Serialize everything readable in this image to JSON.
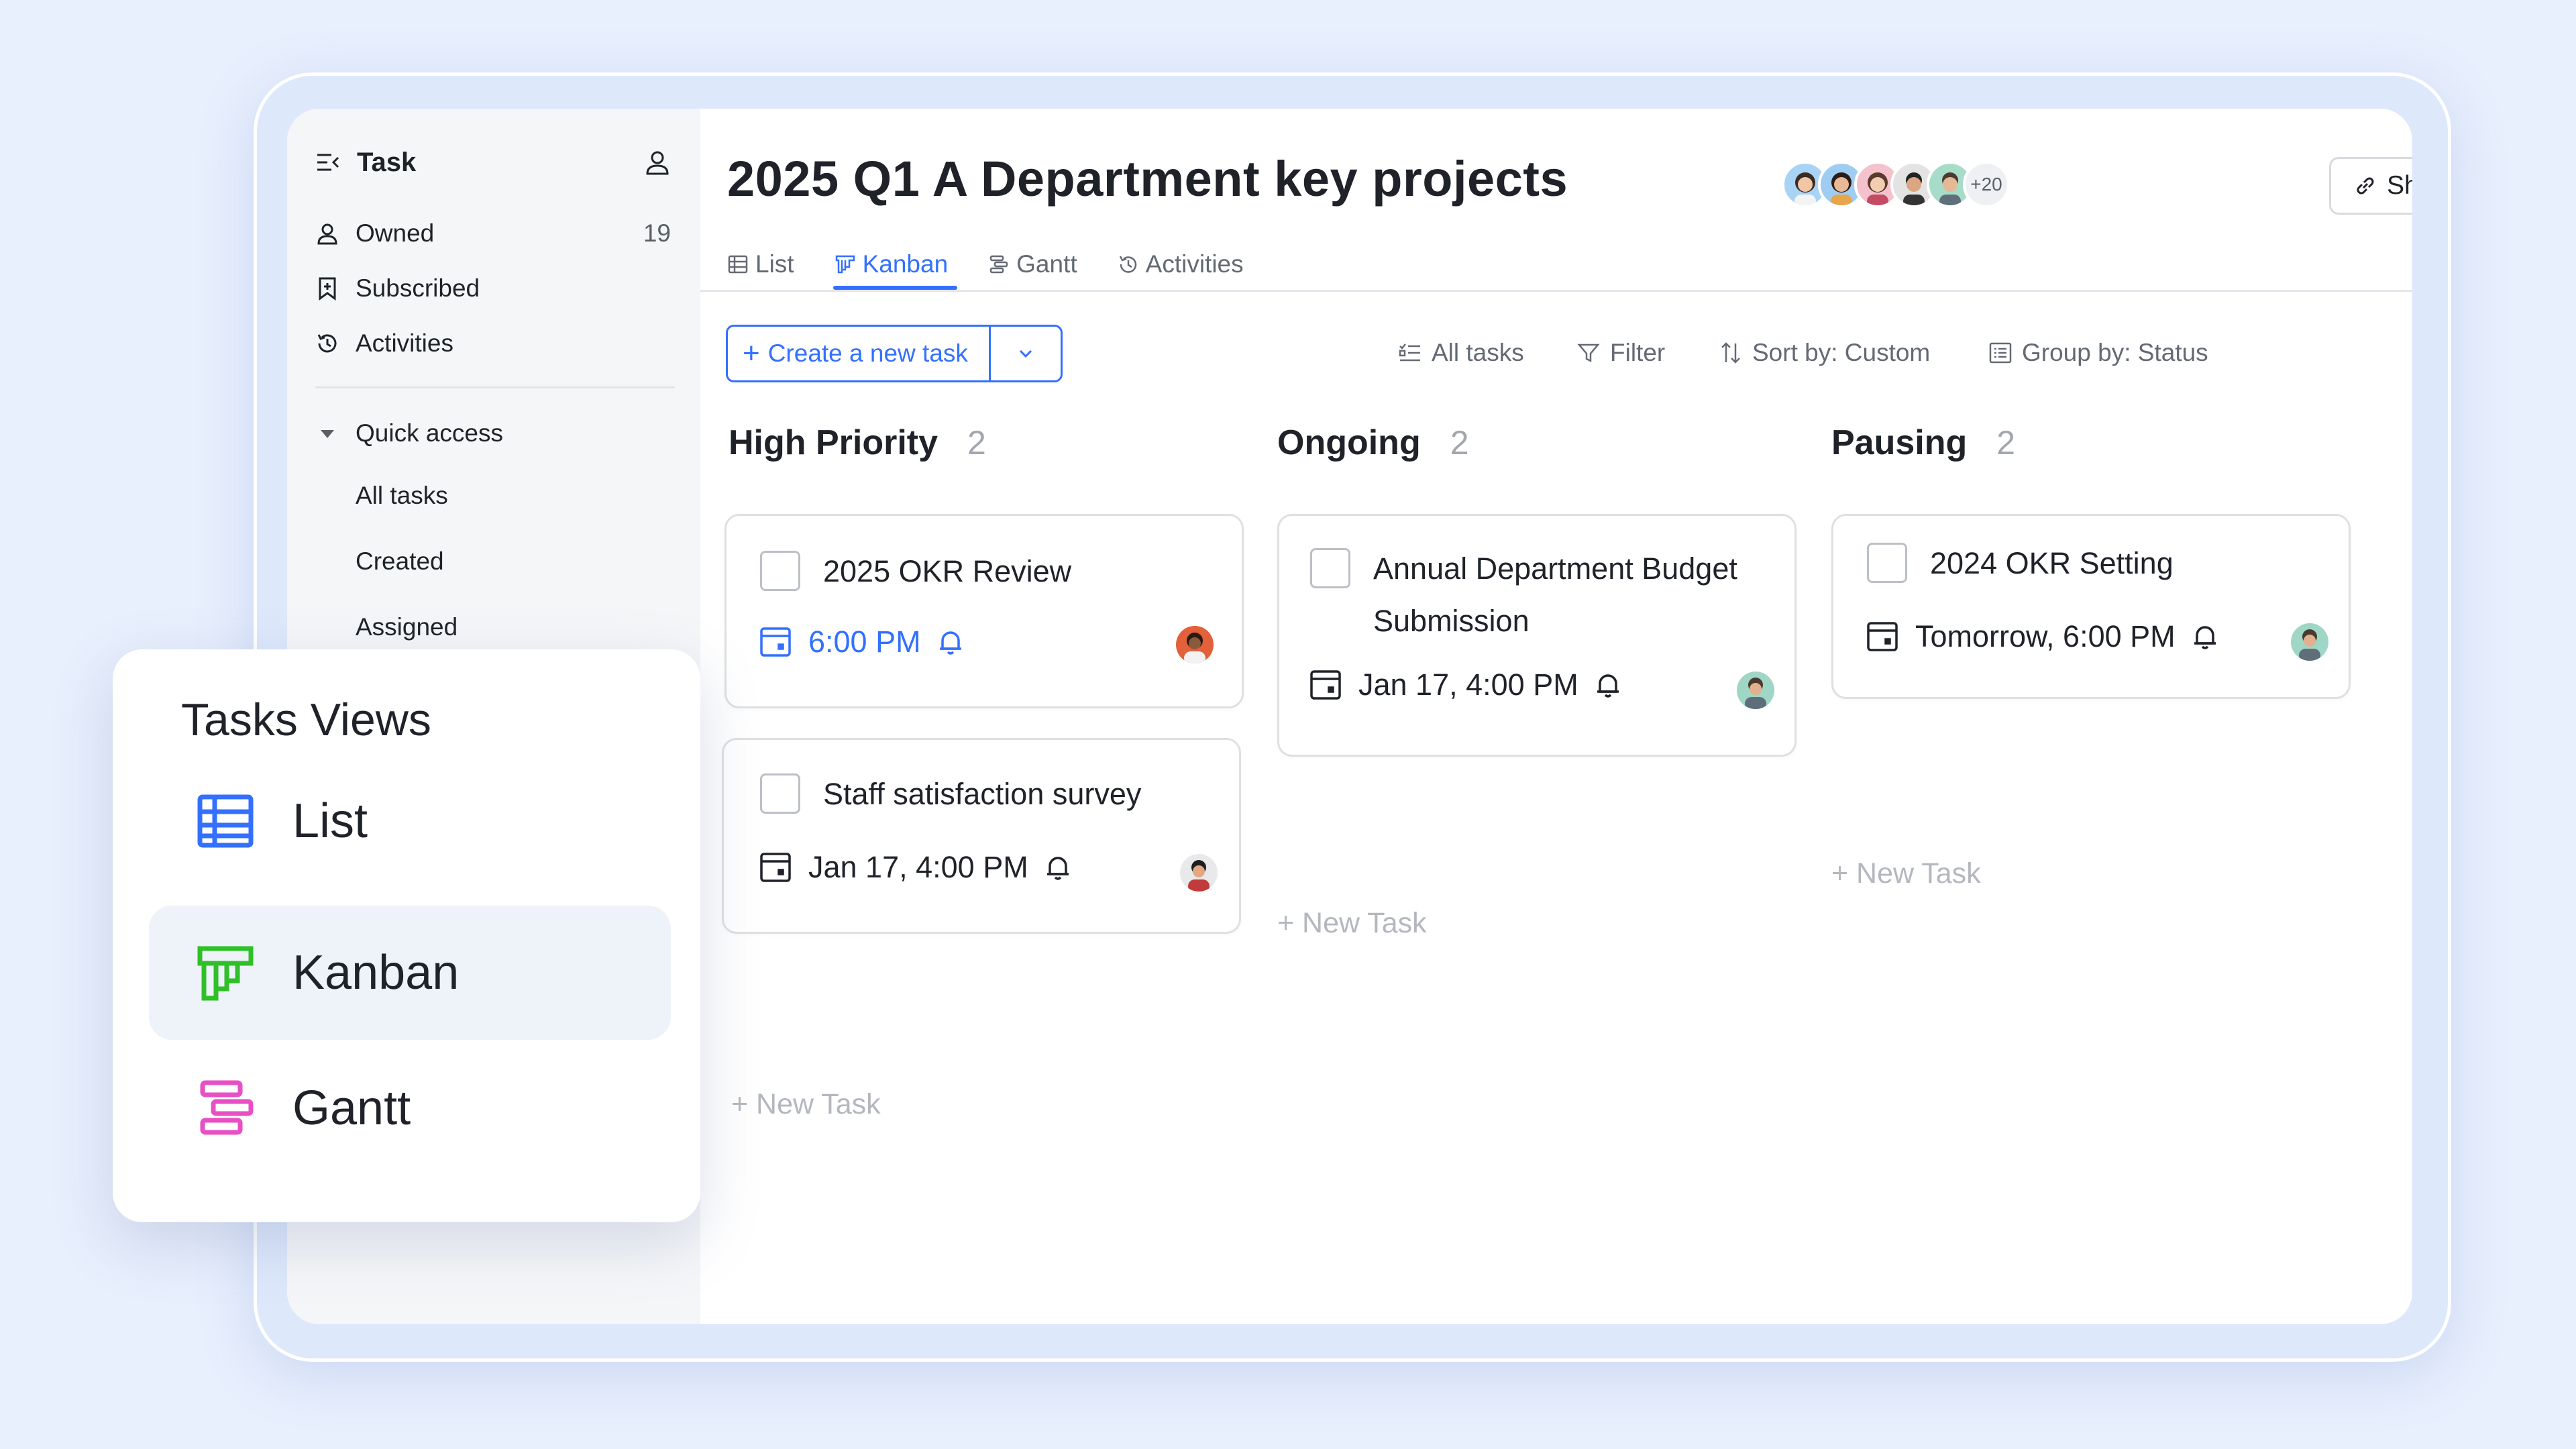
{
  "sidebar": {
    "title": "Task",
    "items": [
      {
        "label": "Owned",
        "count": "19"
      },
      {
        "label": "Subscribed"
      },
      {
        "label": "Activities"
      }
    ],
    "quick_access": {
      "label": "Quick access",
      "items": [
        "All tasks",
        "Created",
        "Assigned"
      ]
    }
  },
  "header": {
    "title": "2025 Q1 A Department key projects",
    "more_members": "+20",
    "share_label": "Share",
    "tabs": [
      {
        "label": "List",
        "icon": "table-icon"
      },
      {
        "label": "Kanban",
        "icon": "kanban-icon",
        "active": true
      },
      {
        "label": "Gantt",
        "icon": "gantt-icon"
      },
      {
        "label": "Activities",
        "icon": "history-icon"
      }
    ]
  },
  "toolbar": {
    "create_label": "Create a new task",
    "all_tasks": "All tasks",
    "filter": "Filter",
    "sort": "Sort by: Custom",
    "group": "Group by: Status"
  },
  "columns": [
    {
      "name": "High Priority",
      "count": "2",
      "cards": [
        {
          "title": "2025 OKR Review",
          "time": "6:00 PM"
        },
        {
          "title": "Staff satisfaction survey",
          "time": "Jan 17, 4:00 PM"
        }
      ],
      "new_task": "+ New Task"
    },
    {
      "name": "Ongoing",
      "count": "2",
      "cards": [
        {
          "title": "Annual Department Budget Submission",
          "time": "Jan 17, 4:00 PM"
        }
      ],
      "new_task": "+ New Task"
    },
    {
      "name": "Pausing",
      "count": "2",
      "cards": [
        {
          "title": "2024 OKR Setting",
          "time": "Tomorrow, 6:00 PM"
        }
      ],
      "new_task": "+ New Task"
    }
  ],
  "views_panel": {
    "title": "Tasks Views",
    "items": [
      {
        "label": "List",
        "icon": "table-icon",
        "color": "#3370ff"
      },
      {
        "label": "Kanban",
        "icon": "kanban-icon",
        "color": "#2ec026",
        "selected": true
      },
      {
        "label": "Gantt",
        "icon": "gantt-icon",
        "color": "#e84fc4"
      }
    ]
  },
  "colors": {
    "accent": "#3370ff",
    "muted": "#646a73",
    "background": "#e8effd"
  }
}
